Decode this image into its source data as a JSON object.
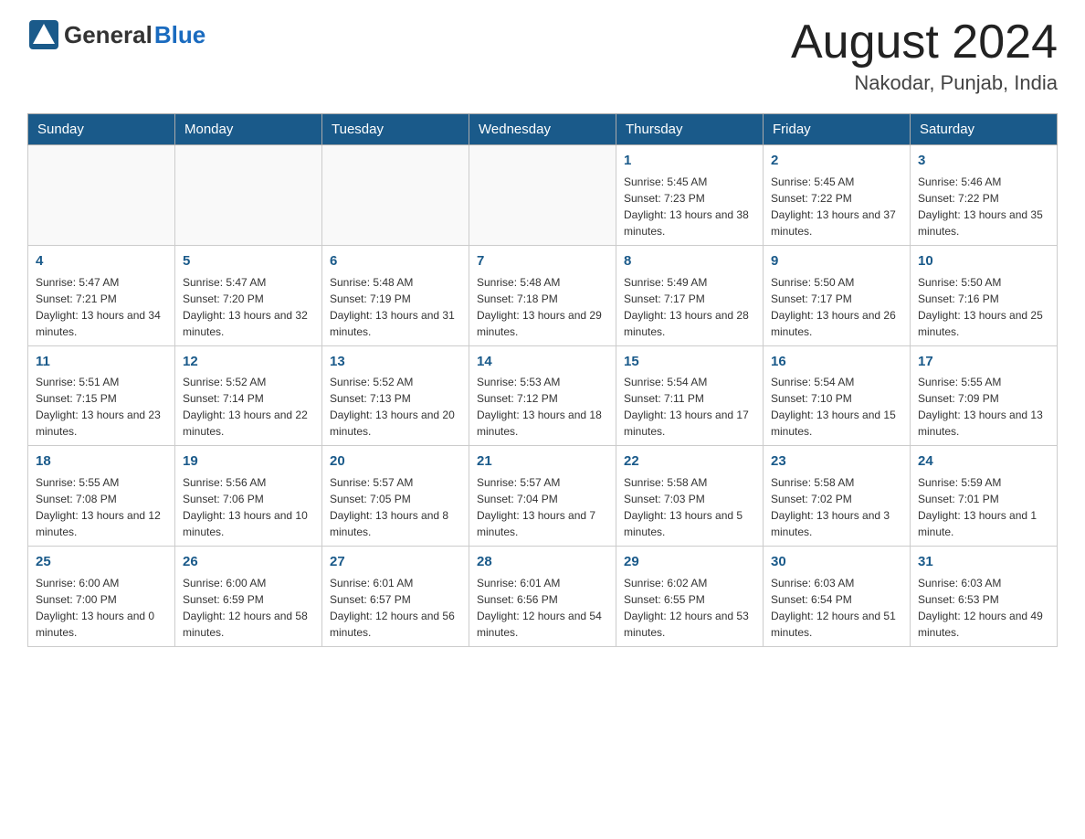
{
  "header": {
    "logo_general": "General",
    "logo_blue": "Blue",
    "month_title": "August 2024",
    "location": "Nakodar, Punjab, India"
  },
  "weekdays": [
    "Sunday",
    "Monday",
    "Tuesday",
    "Wednesday",
    "Thursday",
    "Friday",
    "Saturday"
  ],
  "weeks": [
    [
      {
        "day": "",
        "info": ""
      },
      {
        "day": "",
        "info": ""
      },
      {
        "day": "",
        "info": ""
      },
      {
        "day": "",
        "info": ""
      },
      {
        "day": "1",
        "info": "Sunrise: 5:45 AM\nSunset: 7:23 PM\nDaylight: 13 hours and 38 minutes."
      },
      {
        "day": "2",
        "info": "Sunrise: 5:45 AM\nSunset: 7:22 PM\nDaylight: 13 hours and 37 minutes."
      },
      {
        "day": "3",
        "info": "Sunrise: 5:46 AM\nSunset: 7:22 PM\nDaylight: 13 hours and 35 minutes."
      }
    ],
    [
      {
        "day": "4",
        "info": "Sunrise: 5:47 AM\nSunset: 7:21 PM\nDaylight: 13 hours and 34 minutes."
      },
      {
        "day": "5",
        "info": "Sunrise: 5:47 AM\nSunset: 7:20 PM\nDaylight: 13 hours and 32 minutes."
      },
      {
        "day": "6",
        "info": "Sunrise: 5:48 AM\nSunset: 7:19 PM\nDaylight: 13 hours and 31 minutes."
      },
      {
        "day": "7",
        "info": "Sunrise: 5:48 AM\nSunset: 7:18 PM\nDaylight: 13 hours and 29 minutes."
      },
      {
        "day": "8",
        "info": "Sunrise: 5:49 AM\nSunset: 7:17 PM\nDaylight: 13 hours and 28 minutes."
      },
      {
        "day": "9",
        "info": "Sunrise: 5:50 AM\nSunset: 7:17 PM\nDaylight: 13 hours and 26 minutes."
      },
      {
        "day": "10",
        "info": "Sunrise: 5:50 AM\nSunset: 7:16 PM\nDaylight: 13 hours and 25 minutes."
      }
    ],
    [
      {
        "day": "11",
        "info": "Sunrise: 5:51 AM\nSunset: 7:15 PM\nDaylight: 13 hours and 23 minutes."
      },
      {
        "day": "12",
        "info": "Sunrise: 5:52 AM\nSunset: 7:14 PM\nDaylight: 13 hours and 22 minutes."
      },
      {
        "day": "13",
        "info": "Sunrise: 5:52 AM\nSunset: 7:13 PM\nDaylight: 13 hours and 20 minutes."
      },
      {
        "day": "14",
        "info": "Sunrise: 5:53 AM\nSunset: 7:12 PM\nDaylight: 13 hours and 18 minutes."
      },
      {
        "day": "15",
        "info": "Sunrise: 5:54 AM\nSunset: 7:11 PM\nDaylight: 13 hours and 17 minutes."
      },
      {
        "day": "16",
        "info": "Sunrise: 5:54 AM\nSunset: 7:10 PM\nDaylight: 13 hours and 15 minutes."
      },
      {
        "day": "17",
        "info": "Sunrise: 5:55 AM\nSunset: 7:09 PM\nDaylight: 13 hours and 13 minutes."
      }
    ],
    [
      {
        "day": "18",
        "info": "Sunrise: 5:55 AM\nSunset: 7:08 PM\nDaylight: 13 hours and 12 minutes."
      },
      {
        "day": "19",
        "info": "Sunrise: 5:56 AM\nSunset: 7:06 PM\nDaylight: 13 hours and 10 minutes."
      },
      {
        "day": "20",
        "info": "Sunrise: 5:57 AM\nSunset: 7:05 PM\nDaylight: 13 hours and 8 minutes."
      },
      {
        "day": "21",
        "info": "Sunrise: 5:57 AM\nSunset: 7:04 PM\nDaylight: 13 hours and 7 minutes."
      },
      {
        "day": "22",
        "info": "Sunrise: 5:58 AM\nSunset: 7:03 PM\nDaylight: 13 hours and 5 minutes."
      },
      {
        "day": "23",
        "info": "Sunrise: 5:58 AM\nSunset: 7:02 PM\nDaylight: 13 hours and 3 minutes."
      },
      {
        "day": "24",
        "info": "Sunrise: 5:59 AM\nSunset: 7:01 PM\nDaylight: 13 hours and 1 minute."
      }
    ],
    [
      {
        "day": "25",
        "info": "Sunrise: 6:00 AM\nSunset: 7:00 PM\nDaylight: 13 hours and 0 minutes."
      },
      {
        "day": "26",
        "info": "Sunrise: 6:00 AM\nSunset: 6:59 PM\nDaylight: 12 hours and 58 minutes."
      },
      {
        "day": "27",
        "info": "Sunrise: 6:01 AM\nSunset: 6:57 PM\nDaylight: 12 hours and 56 minutes."
      },
      {
        "day": "28",
        "info": "Sunrise: 6:01 AM\nSunset: 6:56 PM\nDaylight: 12 hours and 54 minutes."
      },
      {
        "day": "29",
        "info": "Sunrise: 6:02 AM\nSunset: 6:55 PM\nDaylight: 12 hours and 53 minutes."
      },
      {
        "day": "30",
        "info": "Sunrise: 6:03 AM\nSunset: 6:54 PM\nDaylight: 12 hours and 51 minutes."
      },
      {
        "day": "31",
        "info": "Sunrise: 6:03 AM\nSunset: 6:53 PM\nDaylight: 12 hours and 49 minutes."
      }
    ]
  ]
}
